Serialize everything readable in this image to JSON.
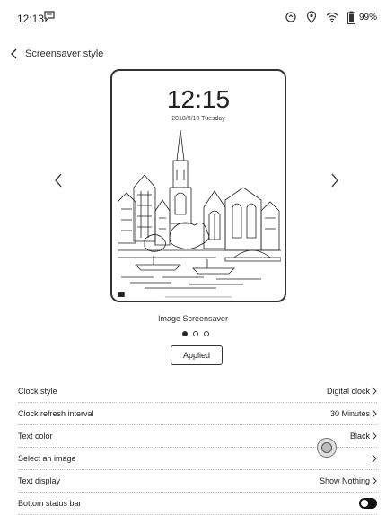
{
  "status_bar": {
    "time": "12:13",
    "battery": "99%",
    "icons": [
      "chat-icon",
      "sync-icon",
      "location-icon",
      "wifi-icon",
      "battery-icon"
    ]
  },
  "header": {
    "title": "Screensaver style"
  },
  "preview": {
    "clock": "12:15",
    "date": "2018/9/10  Tuesday",
    "caption": "Image Screensaver",
    "page_count": 3,
    "active_page": 1
  },
  "applied_button": "Applied",
  "settings": {
    "rows": [
      {
        "label": "Clock style",
        "value": "Digital clock"
      },
      {
        "label": "Clock refresh interval",
        "value": "30 Minutes"
      },
      {
        "label": "Text color",
        "value": "Black"
      },
      {
        "label": "Select an image",
        "value": ""
      },
      {
        "label": "Text display",
        "value": "Show Nothing"
      },
      {
        "label": "Bottom status bar",
        "toggle": true
      }
    ]
  }
}
